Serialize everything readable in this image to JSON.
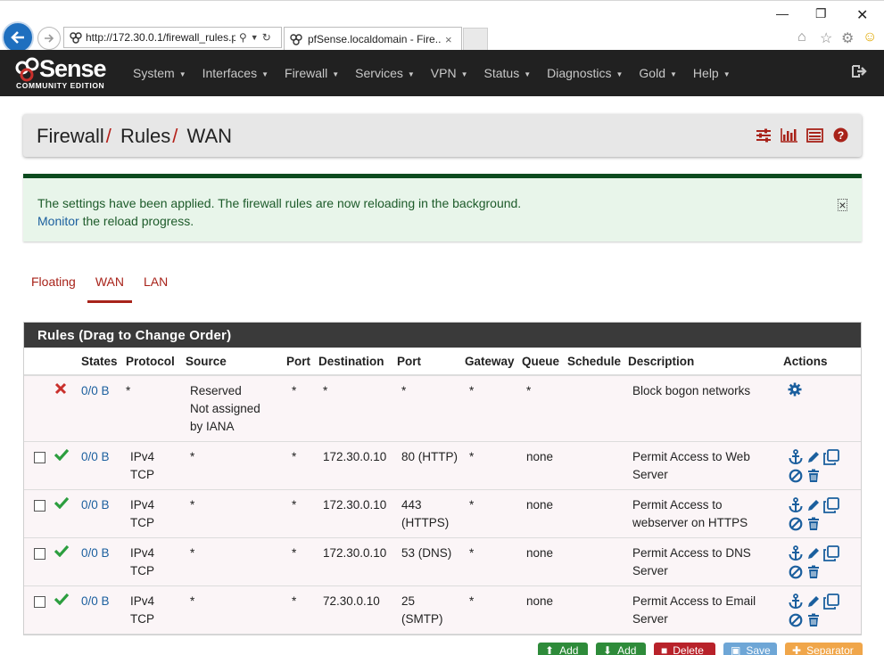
{
  "browser": {
    "url": "http://172.30.0.1/firewall_rules.p",
    "tab_title": "pfSense.localdomain - Fire...",
    "tab_close": "×"
  },
  "navbar": {
    "logo_text": "Sense",
    "logo_sub": "COMMUNITY EDITION",
    "items": [
      {
        "label": "System"
      },
      {
        "label": "Interfaces"
      },
      {
        "label": "Firewall"
      },
      {
        "label": "Services"
      },
      {
        "label": "VPN"
      },
      {
        "label": "Status"
      },
      {
        "label": "Diagnostics"
      },
      {
        "label": "Gold"
      },
      {
        "label": "Help"
      }
    ]
  },
  "breadcrumb": {
    "part1": "Firewall",
    "part2": "Rules",
    "part3": "WAN",
    "separator": "/"
  },
  "alert": {
    "line1": "The settings have been applied. The firewall rules are now reloading in the background.",
    "link": "Monitor",
    "line2_rest": " the reload progress.",
    "close": "×"
  },
  "tabs": [
    {
      "label": "Floating",
      "active": false
    },
    {
      "label": "WAN",
      "active": true
    },
    {
      "label": "LAN",
      "active": false
    }
  ],
  "rules_panel": {
    "title": "Rules (Drag to Change Order)",
    "headers": {
      "states": "States",
      "protocol": "Protocol",
      "source": "Source",
      "port": "Port",
      "destination": "Destination",
      "dport": "Port",
      "gateway": "Gateway",
      "queue": "Queue",
      "schedule": "Schedule",
      "description": "Description",
      "actions": "Actions"
    },
    "rows": [
      {
        "type": "block",
        "states": "0/0 B",
        "protocol": "*",
        "source_l1": "Reserved",
        "source_l2": "Not assigned",
        "source_l3": "by IANA",
        "port": "*",
        "destination": "*",
        "dport": "*",
        "gateway": "*",
        "queue": "*",
        "schedule": "",
        "description": "Block bogon networks"
      },
      {
        "type": "pass",
        "states": "0/0 B",
        "protocol_l1": "IPv4",
        "protocol_l2": "TCP",
        "source": "*",
        "port": "*",
        "destination": "172.30.0.10",
        "dport_l1": "80 (HTTP)",
        "dport_l2": "",
        "gateway": "*",
        "queue": "none",
        "schedule": "",
        "description_l1": "Permit Access to Web",
        "description_l2": "Server"
      },
      {
        "type": "pass",
        "states": "0/0 B",
        "protocol_l1": "IPv4",
        "protocol_l2": "TCP",
        "source": "*",
        "port": "*",
        "destination": "172.30.0.10",
        "dport_l1": "443",
        "dport_l2": "(HTTPS)",
        "gateway": "*",
        "queue": "none",
        "schedule": "",
        "description_l1": "Permit Access to",
        "description_l2": "webserver on HTTPS"
      },
      {
        "type": "pass",
        "states": "0/0 B",
        "protocol_l1": "IPv4",
        "protocol_l2": "TCP",
        "source": "*",
        "port": "*",
        "destination": "172.30.0.10",
        "dport_l1": "53 (DNS)",
        "dport_l2": "",
        "gateway": "*",
        "queue": "none",
        "schedule": "",
        "description_l1": "Permit Access to DNS",
        "description_l2": "Server"
      },
      {
        "type": "pass",
        "states": "0/0 B",
        "protocol_l1": "IPv4",
        "protocol_l2": "TCP",
        "source": "*",
        "port": "*",
        "destination": "72.30.0.10",
        "dport_l1": "25 (SMTP)",
        "dport_l2": "",
        "gateway": "*",
        "queue": "none",
        "schedule": "",
        "description_l1": "Permit Access to Email",
        "description_l2": "Server"
      }
    ]
  },
  "buttons": {
    "add_top": "Add",
    "add_bottom": "Add",
    "delete": "Delete",
    "save": "Save",
    "separator": "Separator"
  },
  "colors": {
    "navbar_bg": "#212121",
    "brand_red": "#a8231a",
    "link_blue": "#1b5f9e",
    "pass_green": "#2c9e3f",
    "block_red": "#c9302c"
  }
}
